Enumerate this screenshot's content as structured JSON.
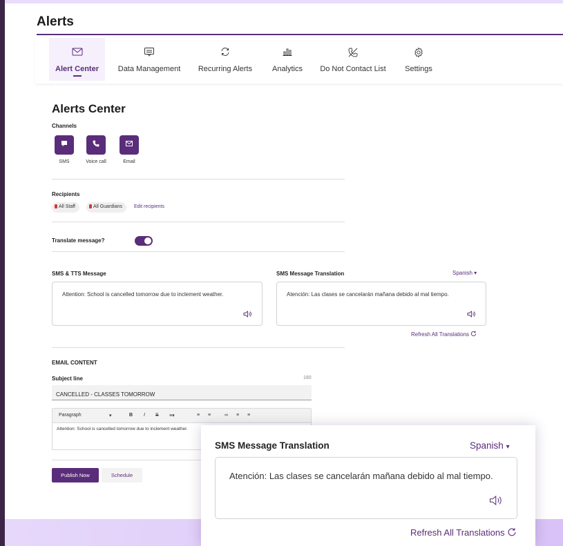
{
  "header": {
    "title": "Alerts"
  },
  "tabs": [
    {
      "label": "Alert Center",
      "icon": "envelope-icon",
      "active": true
    },
    {
      "label": "Data Management",
      "icon": "message-square-icon",
      "active": false
    },
    {
      "label": "Recurring Alerts",
      "icon": "refresh-icon",
      "active": false
    },
    {
      "label": "Analytics",
      "icon": "bar-chart-icon",
      "active": false
    },
    {
      "label": "Do Not Contact List",
      "icon": "phone-off-icon",
      "active": false
    },
    {
      "label": "Settings",
      "icon": "gear-icon",
      "active": false
    }
  ],
  "main": {
    "title": "Alerts Center",
    "channels": {
      "label": "Channels",
      "items": [
        {
          "label": "SMS",
          "icon": "chat-bubble-icon"
        },
        {
          "label": "Voice call",
          "icon": "phone-icon"
        },
        {
          "label": "Email",
          "icon": "envelope-icon"
        }
      ]
    },
    "recipients": {
      "label": "Recipients",
      "items": [
        "All Staff",
        "All Guardians"
      ],
      "edit_label": "Edit recipients"
    },
    "translate": {
      "label": "Translate message?",
      "enabled": true
    },
    "sms": {
      "label": "SMS & TTS Message",
      "message": "Attention: School is cancelled tomorrow due to inclement weather."
    },
    "translation": {
      "label": "SMS Message Translation",
      "language": "Spanish",
      "message": "Atención: Las clases se cancelarán mañana debido al mal tiempo.",
      "refresh_label": "Refresh All Translations"
    },
    "email": {
      "heading": "EMAIL CONTENT",
      "subject_label": "Subject line",
      "subject_count": "180",
      "subject_value": "CANCELLED - CLASSES TOMORROW",
      "toolbar": {
        "paragraph": "Paragraph",
        "bold": "B",
        "italic": "I",
        "strike": "S"
      },
      "body": "Attention: School is cancelled tomorrow due to inclement weather."
    },
    "actions": {
      "publish": "Publish Now",
      "schedule": "Schedule"
    }
  },
  "colors": {
    "accent": "#5a2d7a",
    "background": "#e9ddfb",
    "badge_dot": "#d23a3a"
  }
}
